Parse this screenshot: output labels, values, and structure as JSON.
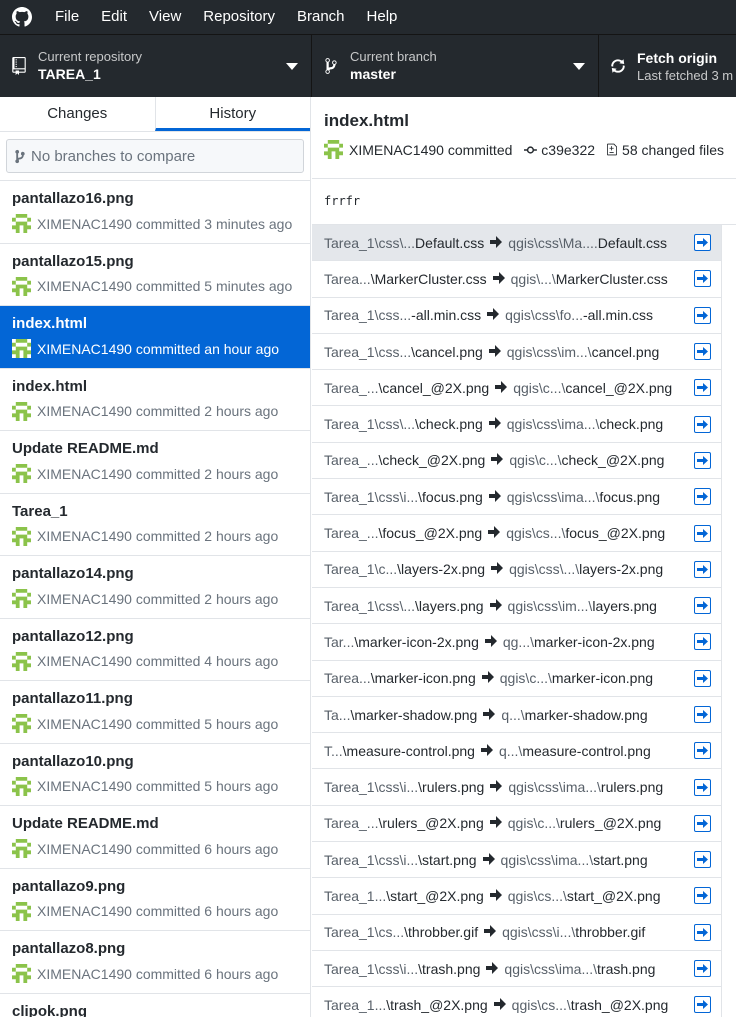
{
  "menubar": {
    "items": [
      "File",
      "Edit",
      "View",
      "Repository",
      "Branch",
      "Help"
    ]
  },
  "toolbar": {
    "repo_label": "Current repository",
    "repo_value": "TAREA_1",
    "branch_label": "Current branch",
    "branch_value": "master",
    "fetch_label": "Fetch origin",
    "fetch_sub": "Last fetched 3 m"
  },
  "sidebar": {
    "tabs": [
      "Changes",
      "History"
    ],
    "selected_tab": "History",
    "compare_placeholder": "No branches to compare",
    "commits": [
      {
        "title": "pantallazo16.png",
        "meta": "XIMENAC1490 committed 3 minutes ago"
      },
      {
        "title": "pantallazo15.png",
        "meta": "XIMENAC1490 committed 5 minutes ago"
      },
      {
        "title": "index.html",
        "meta": "XIMENAC1490 committed an hour ago",
        "selected": true
      },
      {
        "title": "index.html",
        "meta": "XIMENAC1490 committed 2 hours ago"
      },
      {
        "title": "Update README.md",
        "meta": "XIMENAC1490 committed 2 hours ago"
      },
      {
        "title": "Tarea_1",
        "meta": "XIMENAC1490 committed 2 hours ago"
      },
      {
        "title": "pantallazo14.png",
        "meta": "XIMENAC1490 committed 2 hours ago"
      },
      {
        "title": "pantallazo12.png",
        "meta": "XIMENAC1490 committed 4 hours ago"
      },
      {
        "title": "pantallazo11.png",
        "meta": "XIMENAC1490 committed 5 hours ago"
      },
      {
        "title": "pantallazo10.png",
        "meta": "XIMENAC1490 committed 5 hours ago"
      },
      {
        "title": "Update README.md",
        "meta": "XIMENAC1490 committed 6 hours ago"
      },
      {
        "title": "pantallazo9.png",
        "meta": "XIMENAC1490 committed 6 hours ago"
      },
      {
        "title": "pantallazo8.png",
        "meta": "XIMENAC1490 committed 6 hours ago"
      },
      {
        "title": "clipok.png",
        "meta": ""
      }
    ]
  },
  "main": {
    "title": "index.html",
    "author": "XIMENAC1490 committed",
    "sha": "c39e322",
    "changed_files": "58 changed files",
    "message": "frrfr",
    "files": [
      {
        "old": "Tarea_1\\css\\...",
        "old_end": "Default.css",
        "new": "qgis\\css\\Ma....Default.css",
        "selected": true
      },
      {
        "old": "Tarea...",
        "old_end": "\\MarkerCluster.css",
        "new": "qgis\\...\\MarkerCluster.css"
      },
      {
        "old": "Tarea_1\\css...",
        "old_end": "-all.min.css",
        "new": "qgis\\css\\fo...-all.min.css"
      },
      {
        "old": "Tarea_1\\css...",
        "old_end": "\\cancel.png",
        "new": "qgis\\css\\im...\\cancel.png"
      },
      {
        "old": "Tarea_...",
        "old_end": "\\cancel_@2X.png",
        "new": "qgis\\c...\\cancel_@2X.png"
      },
      {
        "old": "Tarea_1\\css\\...",
        "old_end": "\\check.png",
        "new": "qgis\\css\\ima...\\check.png"
      },
      {
        "old": "Tarea_...",
        "old_end": "\\check_@2X.png",
        "new": "qgis\\c...\\check_@2X.png"
      },
      {
        "old": "Tarea_1\\css\\i...",
        "old_end": "\\focus.png",
        "new": "qgis\\css\\ima...\\focus.png"
      },
      {
        "old": "Tarea_...",
        "old_end": "\\focus_@2X.png",
        "new": "qgis\\cs...\\focus_@2X.png"
      },
      {
        "old": "Tarea_1\\c...",
        "old_end": "\\layers-2x.png",
        "new": "qgis\\css\\...\\layers-2x.png"
      },
      {
        "old": "Tarea_1\\css\\...",
        "old_end": "\\layers.png",
        "new": "qgis\\css\\im...\\layers.png"
      },
      {
        "old": "Tar...",
        "old_end": "\\marker-icon-2x.png",
        "new": "qg...\\marker-icon-2x.png"
      },
      {
        "old": "Tarea...",
        "old_end": "\\marker-icon.png",
        "new": "qgis\\c...\\marker-icon.png"
      },
      {
        "old": "Ta...",
        "old_end": "\\marker-shadow.png",
        "new": "q...\\marker-shadow.png"
      },
      {
        "old": "T...",
        "old_end": "\\measure-control.png",
        "new": "q...\\measure-control.png"
      },
      {
        "old": "Tarea_1\\css\\i...",
        "old_end": "\\rulers.png",
        "new": "qgis\\css\\ima...\\rulers.png"
      },
      {
        "old": "Tarea_...",
        "old_end": "\\rulers_@2X.png",
        "new": "qgis\\c...\\rulers_@2X.png"
      },
      {
        "old": "Tarea_1\\css\\i...",
        "old_end": "\\start.png",
        "new": "qgis\\css\\ima...\\start.png"
      },
      {
        "old": "Tarea_1...",
        "old_end": "\\start_@2X.png",
        "new": "qgis\\cs...\\start_@2X.png"
      },
      {
        "old": "Tarea_1\\cs...",
        "old_end": "\\throbber.gif",
        "new": "qgis\\css\\i...\\throbber.gif"
      },
      {
        "old": "Tarea_1\\css\\i...",
        "old_end": "\\trash.png",
        "new": "qgis\\css\\ima...\\trash.png"
      },
      {
        "old": "Tarea_1...",
        "old_end": "\\trash_@2X.png",
        "new": "qgis\\cs...\\trash_@2X.png"
      }
    ]
  },
  "colors": {
    "accent": "#0366d6",
    "dark_bar": "#24292e",
    "avatar_green": "#8bc34a"
  }
}
